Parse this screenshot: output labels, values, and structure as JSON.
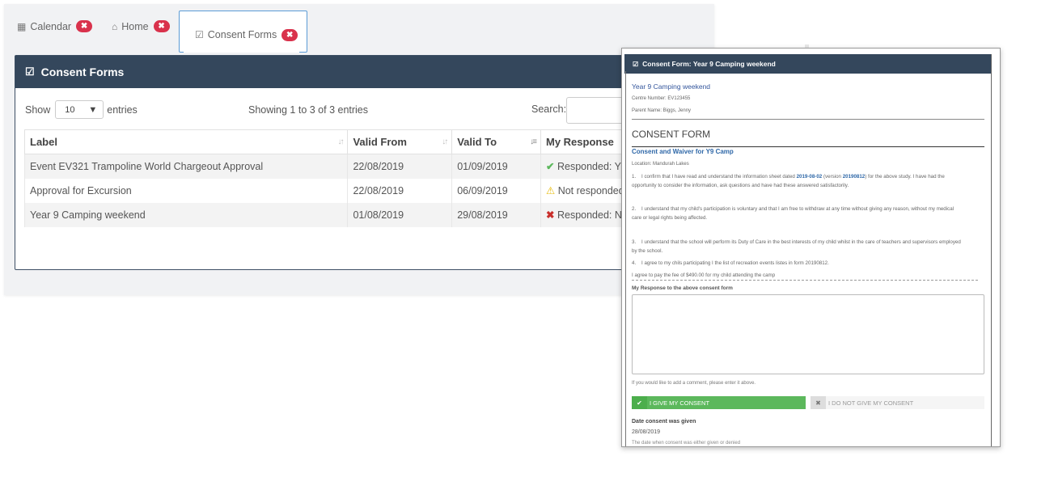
{
  "tabs": [
    {
      "label": "Calendar",
      "icon": "calendar-icon"
    },
    {
      "label": "Home",
      "icon": "home-icon"
    },
    {
      "label": "Consent Forms",
      "icon": "check-square-icon"
    }
  ],
  "panel": {
    "title": "Consent Forms",
    "show_label": "Show",
    "entries_value": "10",
    "entries_label": "entries",
    "info": "Showing 1 to 3 of 3 entries",
    "search_label": "Search:"
  },
  "table": {
    "headers": [
      "Label",
      "Valid From",
      "Valid To",
      "My Response"
    ],
    "rows": [
      {
        "label": "Event EV321 Trampoline World Chargeout Approval",
        "from": "22/08/2019",
        "to": "01/09/2019",
        "response": "Responded: YE",
        "status": "ok"
      },
      {
        "label": "Approval for Excursion",
        "from": "22/08/2019",
        "to": "06/09/2019",
        "response": "Not responded",
        "status": "warn"
      },
      {
        "label": "Year 9 Camping weekend",
        "from": "01/08/2019",
        "to": "29/08/2019",
        "response": "Responded: NO",
        "status": "no"
      }
    ]
  },
  "modal": {
    "title": "Consent Form: Year 9 Camping weekend",
    "event_name": "Year 9 Camping weekend",
    "centre_number": "Centre Number: EV123455",
    "parent_name": "Parent Name: Biggs, Jenny",
    "form_title": "CONSENT FORM",
    "form_subtitle": "Consent and Waiver for Y9 Camp",
    "location": "Location:  Mandurah Lakes",
    "clause1_a": "I confirm that I have read and understand the information sheet dated ",
    "clause1_date": "2019-08-02",
    "clause1_b": " (version ",
    "clause1_version": "20190812",
    "clause1_c": ") for the above study. I have had the opportunity to consider the information, ask questions and have had these answered satisfactorily.",
    "clause2": "I understand that my child's participation is voluntary and that I am free to withdraw at any time without giving any reason, without my medical care or legal rights being affected.",
    "clause3": "I understand that the school will perform its Duty of Care in the best interests of my child whilst in the care of teachers and supervisors employed by the school.",
    "clause4": "I agree to my chils participating I the list of recreation events listes in form 20190812.",
    "fee_line": "I agree to pay the fee of $490.00 for my child attending the camp",
    "response_label": "My Response to the above consent form",
    "comment_hint": "If you would like to add a comment, please enter it above.",
    "give_consent": "I GIVE MY CONSENT",
    "deny_consent": "I DO NOT GIVE MY CONSENT",
    "date_label": "Date consent was given",
    "date_value": "28/08/2019",
    "date_note": "The date when consent was either given or denied"
  },
  "colors": {
    "header": "#34475c",
    "accent": "#5b9bd5",
    "close_badge": "#d9324c",
    "consent_green": "#5cb85c"
  }
}
